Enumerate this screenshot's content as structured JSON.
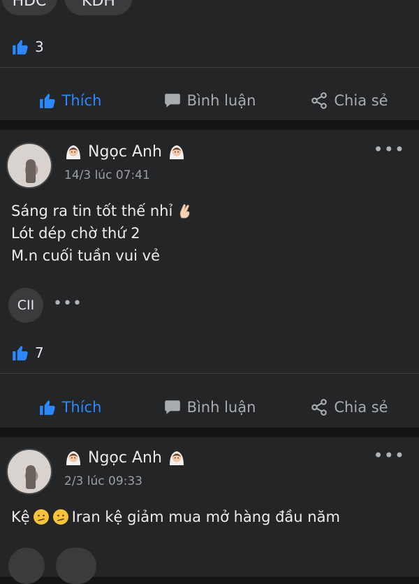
{
  "top_post": {
    "tags": [
      "HDC",
      "KDH"
    ],
    "like_count": "3"
  },
  "actions": {
    "like": "Thích",
    "comment": "Bình luận",
    "share": "Chia sẻ"
  },
  "posts": [
    {
      "author": "Ngọc Anh",
      "time": "14/3 lúc 07:41",
      "lines": [
        "Sáng ra tin tốt thế nhỉ",
        "Lót dép chờ thứ 2",
        "M.n cuối tuần vui vẻ"
      ],
      "reactor_initials": "CII",
      "like_count": "7"
    },
    {
      "author": "Ngọc Anh",
      "time": "2/3 lúc 09:33",
      "lines": [
        "Iran kệ giảm mua mở hàng đầu năm"
      ],
      "prefix_word": "Kệ"
    }
  ],
  "colors": {
    "accent": "#2d88ff",
    "card": "#242526",
    "background": "#141414"
  },
  "icons": [
    "thumbs-up-icon",
    "comment-icon",
    "share-icon",
    "more-icon",
    "bride-emoji",
    "crossed-fingers-emoji",
    "confused-face-emoji"
  ]
}
